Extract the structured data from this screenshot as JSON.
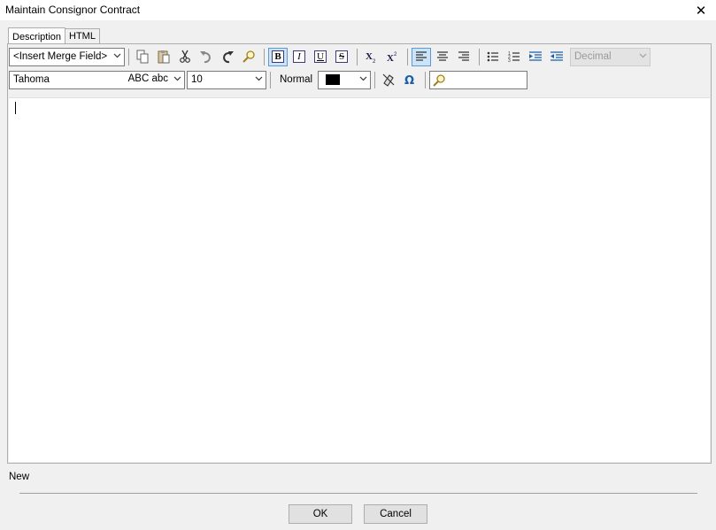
{
  "window": {
    "title": "Maintain Consignor Contract",
    "close_glyph": "✕"
  },
  "tabs": [
    {
      "label": "Description",
      "active": true
    },
    {
      "label": "HTML",
      "active": false
    }
  ],
  "toolbar": {
    "merge_field": {
      "value": "<Insert Merge Field>"
    },
    "icons_row1": [
      "copy-icon",
      "paste-icon",
      "cut-icon",
      "undo-icon",
      "redo-icon",
      "find-icon",
      "bold-icon",
      "italic-icon",
      "underline-icon",
      "strikethrough-icon",
      "subscript-icon",
      "superscript-icon",
      "align-left-icon",
      "align-center-icon",
      "align-right-icon",
      "bullet-list-icon",
      "numbered-list-icon",
      "indent-icon",
      "outdent-icon"
    ],
    "list_style": {
      "value": "Decimal",
      "disabled": true
    },
    "font": {
      "name": "Tahoma",
      "preview": "ABC abc"
    },
    "font_size": {
      "value": "10"
    },
    "paragraph_style": "Normal",
    "text_color": "#000000",
    "icons_row2": [
      "clear-format-icon",
      "special-char-icon",
      "search-icon"
    ],
    "search_placeholder": "",
    "active_color": "#5b9bd5"
  },
  "status_text": "New",
  "buttons": {
    "ok": "OK",
    "cancel": "Cancel"
  }
}
